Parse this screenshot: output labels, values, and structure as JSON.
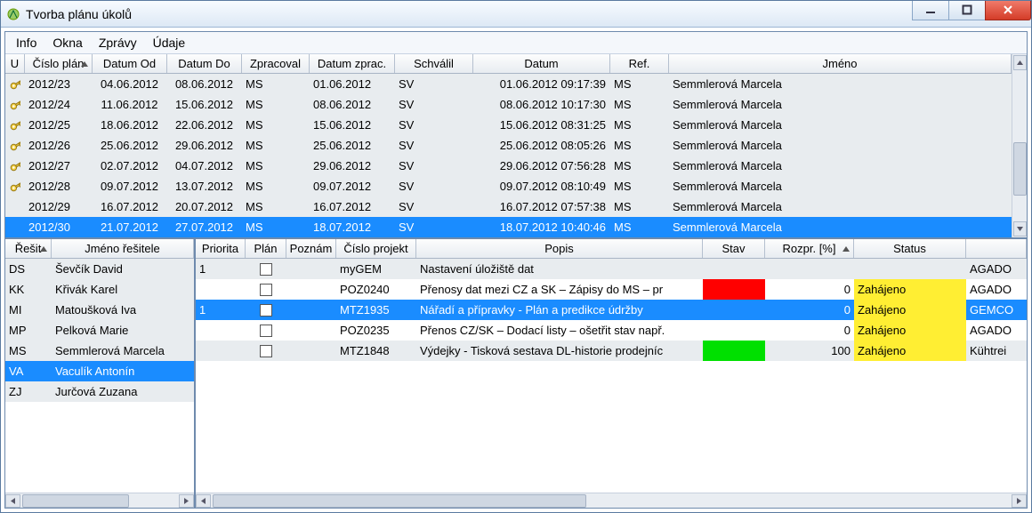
{
  "window": {
    "title": "Tvorba plánu úkolů"
  },
  "menu": {
    "info": "Info",
    "okna": "Okna",
    "zpravy": "Zprávy",
    "udaje": "Údaje"
  },
  "top_grid": {
    "headers": {
      "u": "U",
      "cislo": "Číslo plán",
      "od": "Datum Od",
      "do": "Datum Do",
      "zprac": "Zpracoval",
      "dzprac": "Datum zprac.",
      "schvalil": "Schválil",
      "datum": "Datum",
      "ref": "Ref.",
      "jmeno": "Jméno"
    },
    "rows": [
      {
        "key": true,
        "cislo": "2012/23",
        "od": "04.06.2012",
        "do": "08.06.2012",
        "zprac": "MS",
        "dzprac": "01.06.2012",
        "schvalil": "SV",
        "datum": "01.06.2012 09:17:39",
        "ref": "MS",
        "jmeno": "Semmlerová Marcela"
      },
      {
        "key": true,
        "cislo": "2012/24",
        "od": "11.06.2012",
        "do": "15.06.2012",
        "zprac": "MS",
        "dzprac": "08.06.2012",
        "schvalil": "SV",
        "datum": "08.06.2012 10:17:30",
        "ref": "MS",
        "jmeno": "Semmlerová Marcela"
      },
      {
        "key": true,
        "cislo": "2012/25",
        "od": "18.06.2012",
        "do": "22.06.2012",
        "zprac": "MS",
        "dzprac": "15.06.2012",
        "schvalil": "SV",
        "datum": "15.06.2012 08:31:25",
        "ref": "MS",
        "jmeno": "Semmlerová Marcela"
      },
      {
        "key": true,
        "cislo": "2012/26",
        "od": "25.06.2012",
        "do": "29.06.2012",
        "zprac": "MS",
        "dzprac": "25.06.2012",
        "schvalil": "SV",
        "datum": "25.06.2012 08:05:26",
        "ref": "MS",
        "jmeno": "Semmlerová Marcela"
      },
      {
        "key": true,
        "cislo": "2012/27",
        "od": "02.07.2012",
        "do": "04.07.2012",
        "zprac": "MS",
        "dzprac": "29.06.2012",
        "schvalil": "SV",
        "datum": "29.06.2012 07:56:28",
        "ref": "MS",
        "jmeno": "Semmlerová Marcela"
      },
      {
        "key": true,
        "cislo": "2012/28",
        "od": "09.07.2012",
        "do": "13.07.2012",
        "zprac": "MS",
        "dzprac": "09.07.2012",
        "schvalil": "SV",
        "datum": "09.07.2012 08:10:49",
        "ref": "MS",
        "jmeno": "Semmlerová Marcela"
      },
      {
        "key": false,
        "cislo": "2012/29",
        "od": "16.07.2012",
        "do": "20.07.2012",
        "zprac": "MS",
        "dzprac": "16.07.2012",
        "schvalil": "SV",
        "datum": "16.07.2012 07:57:38",
        "ref": "MS",
        "jmeno": "Semmlerová Marcela"
      },
      {
        "key": false,
        "cislo": "2012/30",
        "od": "21.07.2012",
        "do": "27.07.2012",
        "zprac": "MS",
        "dzprac": "18.07.2012",
        "schvalil": "SV",
        "datum": "18.07.2012 10:40:46",
        "ref": "MS",
        "jmeno": "Semmlerová Marcela",
        "selected": true
      }
    ]
  },
  "left_grid": {
    "headers": {
      "code": "Řešit",
      "name": "Jméno řešitele"
    },
    "rows": [
      {
        "code": "DS",
        "name": "Ševčík David"
      },
      {
        "code": "KK",
        "name": "Křivák Karel"
      },
      {
        "code": "MI",
        "name": "Matoušková Iva"
      },
      {
        "code": "MP",
        "name": "Pelková Marie"
      },
      {
        "code": "MS",
        "name": "Semmlerová Marcela"
      },
      {
        "code": "VA",
        "name": "Vaculík Antonín",
        "selected": true
      },
      {
        "code": "ZJ",
        "name": "Jurčová Zuzana"
      }
    ]
  },
  "right_grid": {
    "headers": {
      "prio": "Priorita",
      "plan": "Plán",
      "pozn": "Poznám",
      "proj": "Číslo projekt",
      "popis": "Popis",
      "stav": "Stav",
      "rozpr": "Rozpr. [%]",
      "status": "Status",
      "extra": ""
    },
    "rows": [
      {
        "prio": "1",
        "proj": "myGEM",
        "popis": "Nastavení úložiště dat",
        "stav": "",
        "rozpr": "",
        "status": "",
        "org": "AGADO"
      },
      {
        "prio": "",
        "proj": "POZ0240",
        "popis": "Přenosy dat mezi CZ a SK – Zápisy do MS – pr",
        "stav": "red",
        "rozpr": "0",
        "status": "Zahájeno",
        "org": "AGADO"
      },
      {
        "prio": "1",
        "proj": "MTZ1935",
        "popis": "Nářadí a přípravky - Plán a predikce údržby",
        "stav": "",
        "rozpr": "0",
        "status": "Zahájeno",
        "org": "GEMCO",
        "selected": true
      },
      {
        "prio": "",
        "proj": "POZ0235",
        "popis": "Přenos CZ/SK – Dodací listy – ošetřit stav např.",
        "stav": "",
        "rozpr": "0",
        "status": "Zahájeno",
        "org": "AGADO"
      },
      {
        "prio": "",
        "proj": "MTZ1848",
        "popis": "Výdejky - Tisková sestava DL-historie prodejníc",
        "stav": "green",
        "rozpr": "100",
        "status": "Zahájeno",
        "org": "Kühtrei"
      }
    ]
  }
}
